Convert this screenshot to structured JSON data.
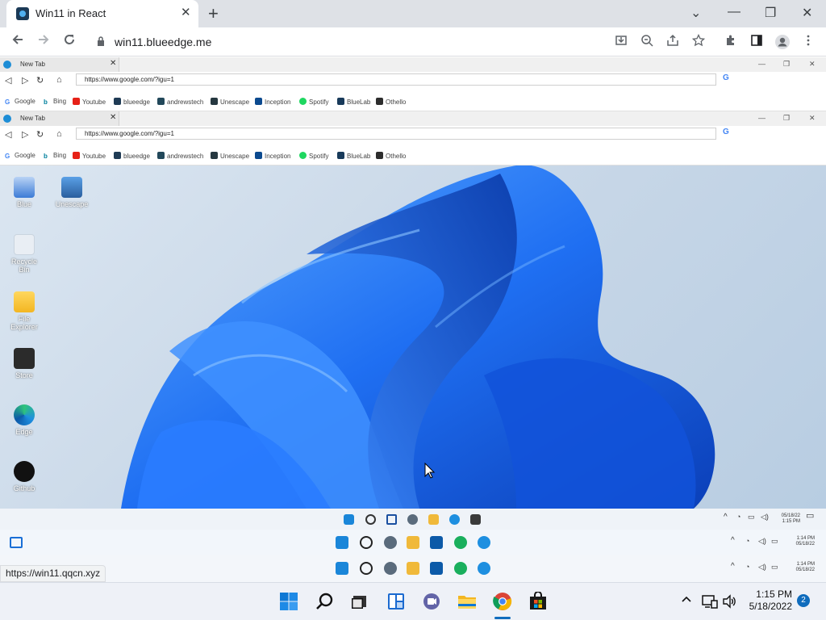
{
  "browser": {
    "tab_title": "Win11 in React",
    "tab_close": "✕",
    "new_tab": "+",
    "url": "win11.blueedge.me",
    "window_controls": [
      "⌄",
      "—",
      "❐",
      "✕"
    ]
  },
  "inner_browsers": [
    {
      "tab_title": "New Tab",
      "url": "https://www.google.com/?igu=1",
      "bookmarks": [
        "Google",
        "Bing",
        "Youtube",
        "blueedge",
        "andrewstech",
        "Unescape",
        "Inception",
        "Spotify",
        "BlueLab",
        "Othello"
      ]
    },
    {
      "tab_title": "New Tab",
      "url": "https://www.google.com/?igu=1",
      "bookmarks": [
        "Google",
        "Bing",
        "Youtube",
        "blueedge",
        "andrewstech",
        "Unescape",
        "Inception",
        "Spotify",
        "BlueLab",
        "Othello"
      ]
    }
  ],
  "desktop_icons": [
    "Blue",
    "Unescape",
    "Recycle Bin",
    "File Explorer",
    "Store",
    "Edge",
    "Github"
  ],
  "inner_taskbars": [
    {
      "time": "1:15 PM",
      "date": "05/18/22"
    },
    {
      "time": "1:14 PM",
      "date": "05/18/22"
    },
    {
      "time": "1:14 PM",
      "date": "05/18/22"
    }
  ],
  "status_url": "https://win11.qqcn.xyz",
  "taskbar": {
    "time": "1:15 PM",
    "date": "5/18/2022",
    "notification_count": "2",
    "icons": [
      "windows-start-icon",
      "search-icon",
      "task-view-icon",
      "widgets-icon",
      "teams-chat-icon",
      "file-explorer-icon",
      "chrome-icon",
      "store-icon"
    ]
  },
  "colors": {
    "accent": "#0f6cbd",
    "wallpaper_blue": "#1f6ff2"
  }
}
